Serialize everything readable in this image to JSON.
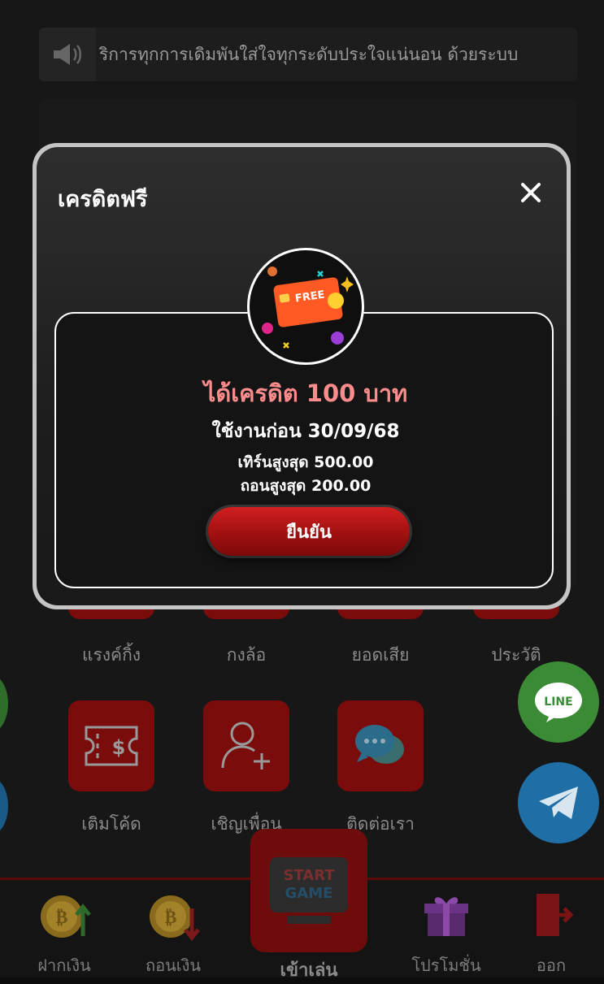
{
  "marquee": {
    "text": "ริการทุกการเดิมพันใส่ใจทุกระดับประใจแน่นอน ด้วยระบบ",
    "icon": "speaker-icon"
  },
  "menu_row1": [
    {
      "label": "แรงค์กิ้ง"
    },
    {
      "label": "กงล้อ"
    },
    {
      "label": "ยอดเสีย"
    },
    {
      "label": "ประวัติ"
    }
  ],
  "menu_row2": [
    {
      "label": "เติมโค้ด",
      "icon": "ticket-dollar-icon"
    },
    {
      "label": "เชิญเพื่อน",
      "icon": "add-user-icon"
    },
    {
      "label": "ติดต่อเรา",
      "icon": "chat-bubbles-icon"
    }
  ],
  "side_buttons": {
    "line_label": "LINE",
    "telegram_icon": "telegram-icon"
  },
  "bottom_nav": {
    "deposit": "ฝากเงิน",
    "withdraw": "ถอนเงิน",
    "play": "เข้าเล่น",
    "promotion": "โปรโมชั่น",
    "logout": "ออก",
    "start_line1": "START",
    "start_line2": "GAME"
  },
  "modal": {
    "title": "เครดิตฟรี",
    "close_icon": "close-icon",
    "card_text": "FREE",
    "headline": "ได้เครดิต 100 บาท",
    "use_before": "ใช้งานก่อน 30/09/68",
    "max_turnover": "เทิร์นสูงสุด 500.00",
    "max_withdraw": "ถอนสูงสุด 200.00",
    "confirm_label": "ยืนยัน"
  },
  "colors": {
    "accent_red": "#c41414",
    "headline_pink": "#ff8c8c",
    "line_green": "#4cb848",
    "telegram_blue": "#2a8fd4"
  }
}
